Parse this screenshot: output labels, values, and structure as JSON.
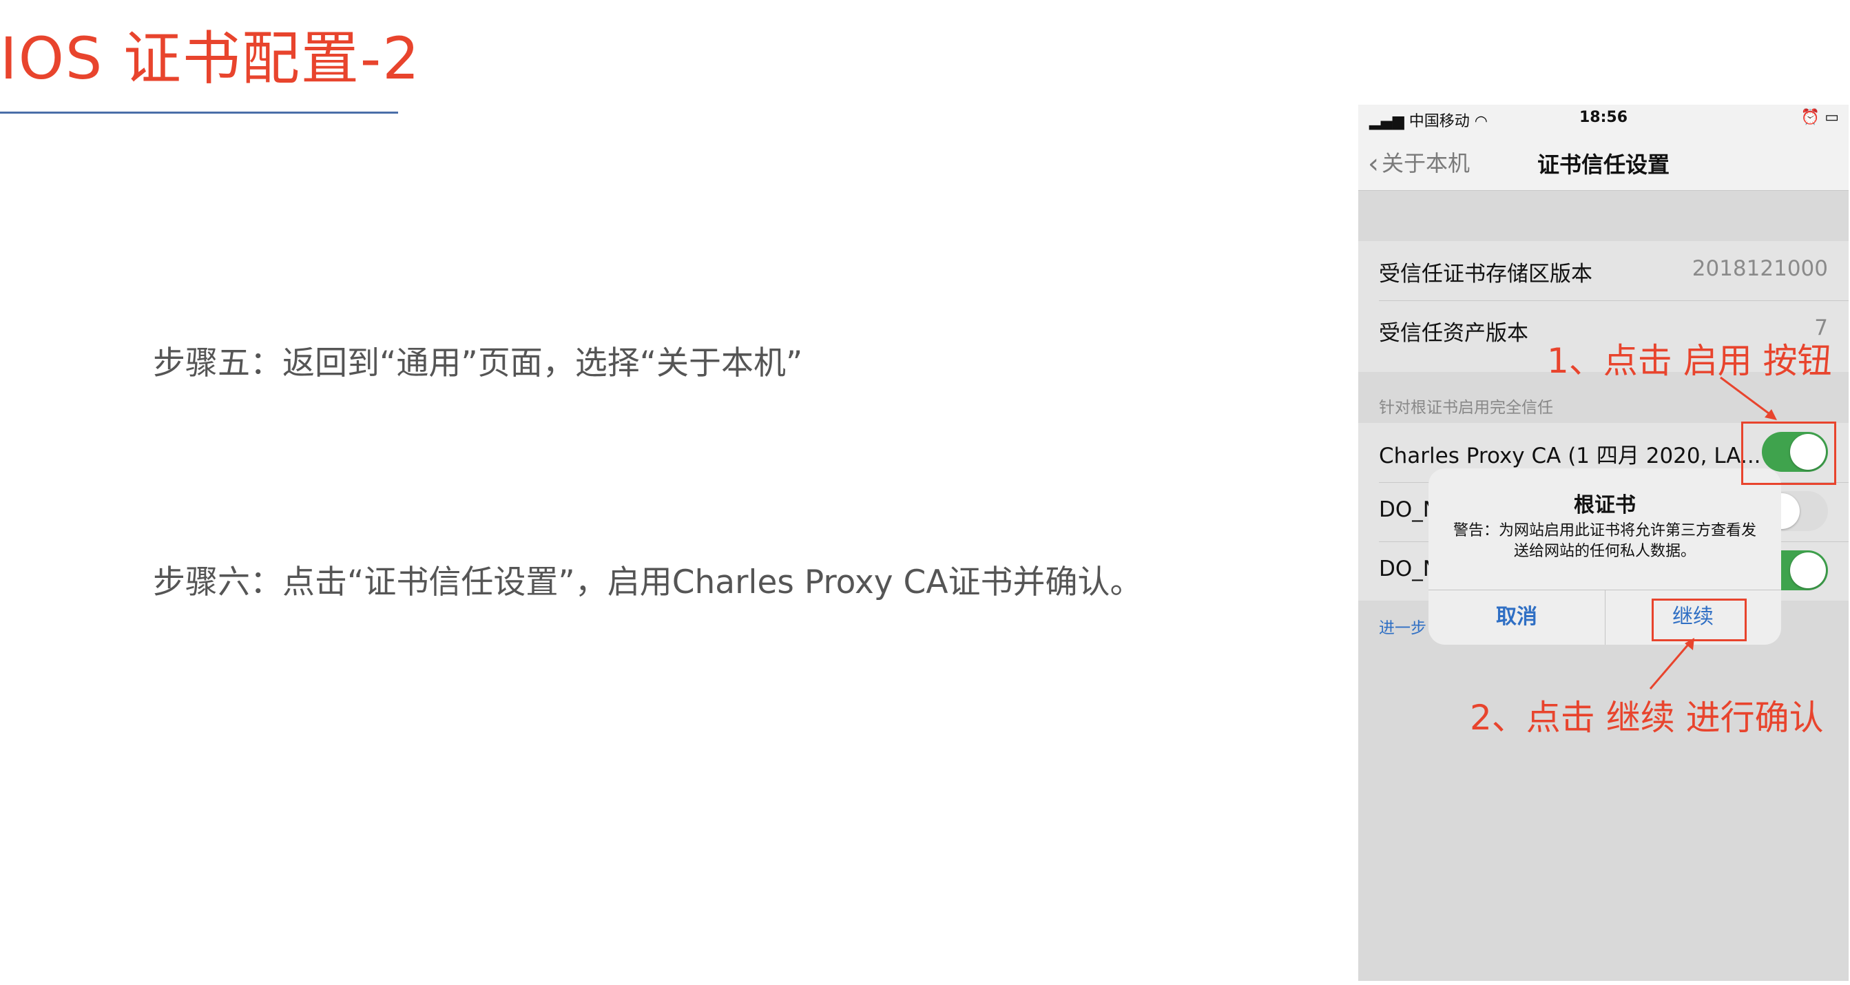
{
  "slide": {
    "title": "IOS 证书配置-2",
    "step5": "步骤五：返回到“通用”页面，选择“关于本机”",
    "step6": "步骤六：点击“证书信任设置”，启用Charles Proxy CA证书并确认。"
  },
  "phone": {
    "status": {
      "carrier": "中国移动",
      "time": "18:56"
    },
    "nav": {
      "back": "关于本机",
      "title": "证书信任设置"
    },
    "rows": {
      "trust_store_label": "受信任证书存储区版本",
      "trust_store_value": "2018121000",
      "asset_label": "受信任资产版本",
      "asset_value": "7"
    },
    "section_header": "针对根证书启用完全信任",
    "certs": [
      {
        "label": "Charles Proxy CA (1 四月 2020, LA...",
        "enabled": true
      },
      {
        "label": "DO_N",
        "enabled": false
      },
      {
        "label": "DO_N",
        "enabled": true
      }
    ],
    "learn_more": "进一步",
    "alert": {
      "title": "根证书",
      "message": "警告：为网站启用此证书将允许第三方查看发送给网站的任何私人数据。",
      "cancel": "取消",
      "continue": "继续"
    }
  },
  "annotations": {
    "note1": "1、点击 启用 按钮",
    "note2": "2、点击 继续 进行确认",
    "color": "#e8442d"
  },
  "colors": {
    "accent": "#e8442d",
    "rule": "#4a6ea8",
    "toggle_on": "#3fa34d",
    "ios_blue": "#2f6fc4"
  }
}
